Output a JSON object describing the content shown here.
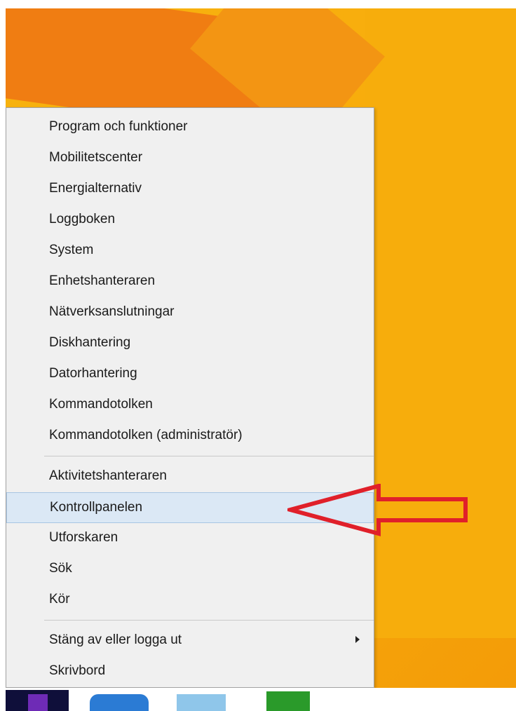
{
  "context_menu": {
    "items_group1": [
      "Program och funktioner",
      "Mobilitetscenter",
      "Energialternativ",
      "Loggboken",
      "System",
      "Enhetshanteraren",
      "Nätverksanslutningar",
      "Diskhantering",
      "Datorhantering",
      "Kommandotolken",
      "Kommandotolken (administratör)"
    ],
    "items_group2": [
      "Aktivitetshanteraren",
      "Kontrollpanelen",
      "Utforskaren",
      "Sök",
      "Kör"
    ],
    "items_group3": [
      "Stäng av eller logga ut",
      "Skrivbord"
    ],
    "highlighted_item": "Kontrollpanelen"
  },
  "annotation": {
    "arrow_color": "#e0202a"
  },
  "colors": {
    "desktop_accent": "#f7b30f",
    "menu_background": "#f0f0f0",
    "highlight_background": "#dbe8f5"
  },
  "taskbar": {
    "icons": [
      "start-icon",
      "internet-explorer-icon",
      "file-explorer-icon",
      "store-icon"
    ]
  }
}
